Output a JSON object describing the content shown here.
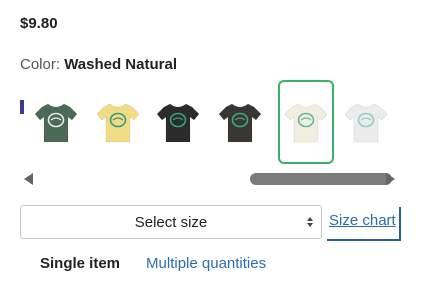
{
  "product": {
    "price": "$9.80",
    "color_label": "Color:",
    "color_value": "Washed Natural"
  },
  "swatches": [
    {
      "name": "green",
      "shirt_color": "#4a6a55",
      "logo_color": "#dfe9e0",
      "selected": false
    },
    {
      "name": "yellow",
      "shirt_color": "#f0dc86",
      "logo_color": "#3a9a80",
      "selected": false
    },
    {
      "name": "black",
      "shirt_color": "#2b2b2b",
      "logo_color": "#38a07c",
      "selected": false
    },
    {
      "name": "charcoal",
      "shirt_color": "#3a3634",
      "logo_color": "#3aa586",
      "selected": false
    },
    {
      "name": "washed-natural",
      "shirt_color": "#f1ede0",
      "logo_color": "#62b99c",
      "selected": true
    },
    {
      "name": "white",
      "shirt_color": "#ececec",
      "logo_color": "#8fd0c3",
      "selected": false
    }
  ],
  "size_select": {
    "placeholder": "Select size"
  },
  "size_chart_label": "Size chart",
  "quantity_tabs": {
    "single": "Single item",
    "multiple": "Multiple quantities"
  },
  "colors": {
    "selected_border": "#3ab06a",
    "link": "#2b6cb0"
  }
}
